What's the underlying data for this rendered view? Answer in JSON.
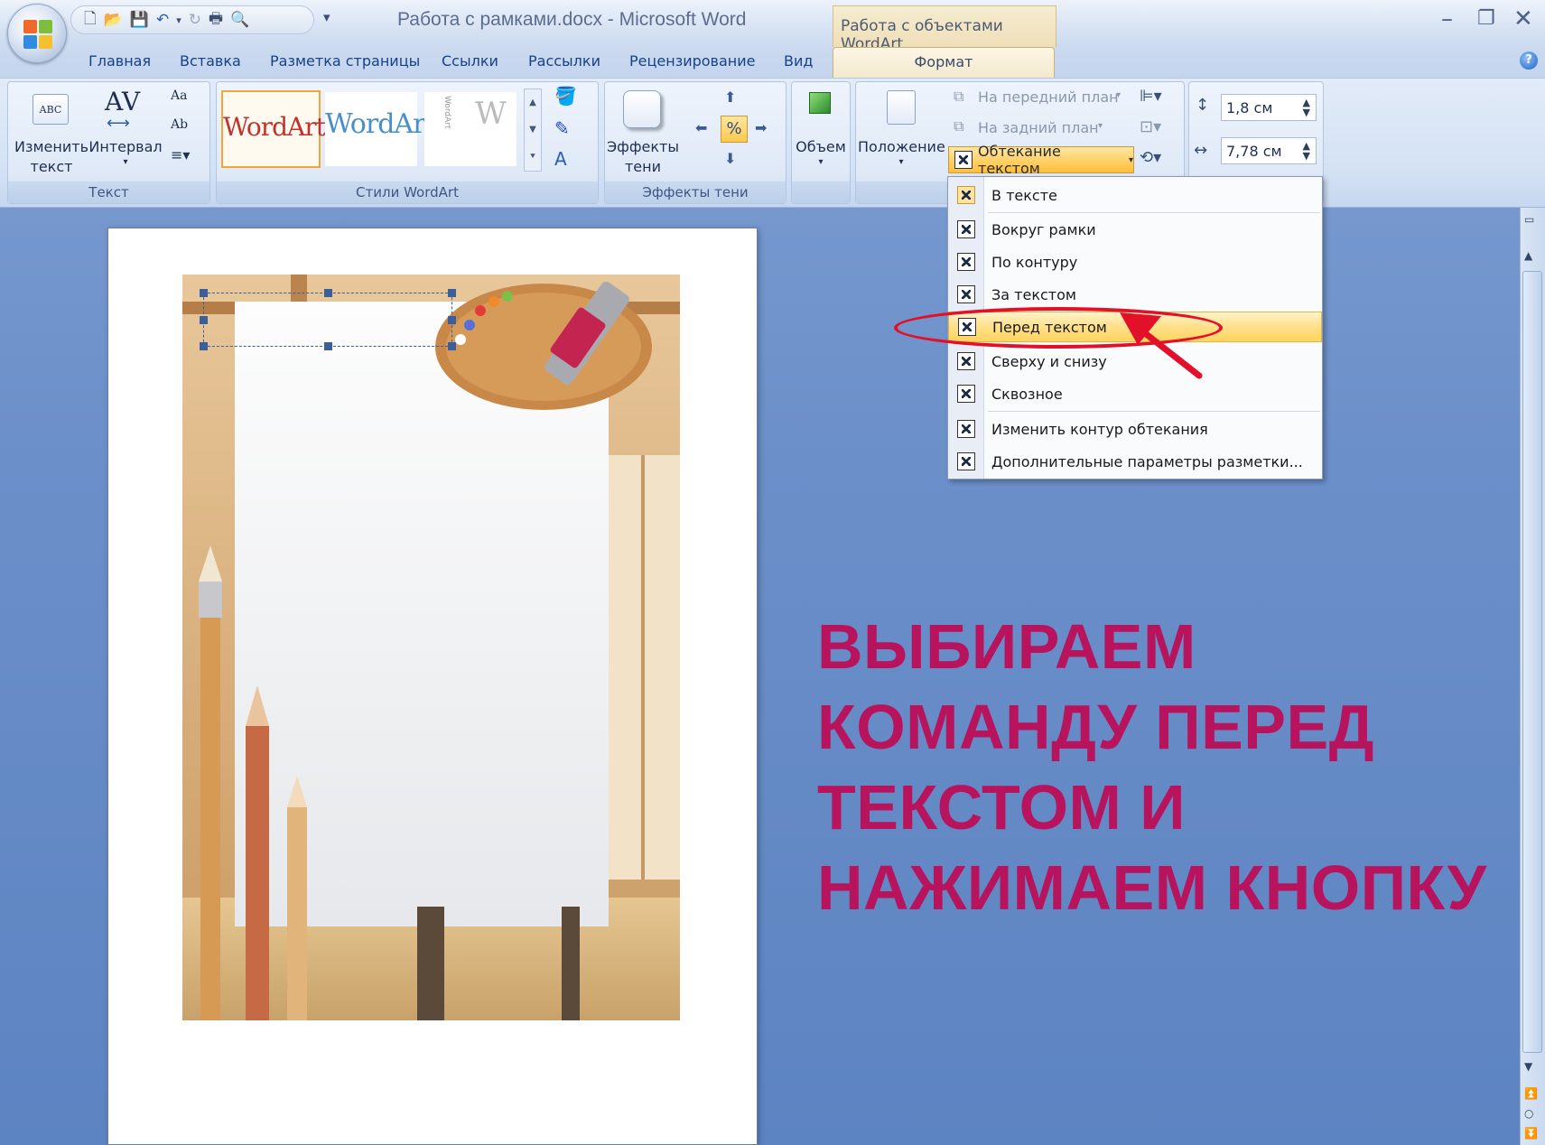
{
  "title_bar": {
    "app_title": "Работа с рамками.docx - Microsoft Word",
    "context_tab_group": "Работа с объектами WordArt",
    "window_controls": [
      "minimize-icon",
      "restore-icon",
      "close-icon"
    ]
  },
  "tabs": [
    "Главная",
    "Вставка",
    "Разметка страницы",
    "Ссылки",
    "Рассылки",
    "Рецензирование",
    "Вид",
    "Формат"
  ],
  "active_tab": "Формат",
  "ribbon": {
    "text_group": {
      "label": "Текст",
      "edit_text_line1": "Изменить",
      "edit_text_line2": "текст",
      "spacing": "Интервал"
    },
    "wordart_styles_group": {
      "label": "Стили WordArt",
      "samples": [
        "WordArt",
        "WordArt"
      ]
    },
    "shadow_group": {
      "label": "Эффекты тени",
      "shadow_line1": "Эффекты",
      "shadow_line2": "тени"
    },
    "volume_label": "Объем",
    "arrange": {
      "position_label": "Положение",
      "bring_front": "На передний план",
      "send_back": "На задний план",
      "text_wrap": "Обтекание текстом"
    },
    "size": {
      "height": "1,8 см",
      "width": "7,78 см"
    }
  },
  "wrap_menu": {
    "items": [
      "В тексте",
      "Вокруг рамки",
      "По контуру",
      "За текстом",
      "Перед текстом",
      "Сверху и снизу",
      "Сквозное",
      "Изменить контур обтекания",
      "Дополнительные параметры разметки..."
    ],
    "highlighted": "Перед текстом"
  },
  "caption": {
    "line1": "ВЫБИРАЕМ",
    "line2": "КОМАНДУ ПЕРЕД",
    "line3": "ТЕКСТОМ И",
    "line4": "НАЖИМАЕМ КНОПКУ"
  },
  "colors": {
    "caption": "#b8145e",
    "annotation": "#e3102a",
    "menu_highlight": "#ffd45e",
    "desktop": "#6b8fc9"
  }
}
